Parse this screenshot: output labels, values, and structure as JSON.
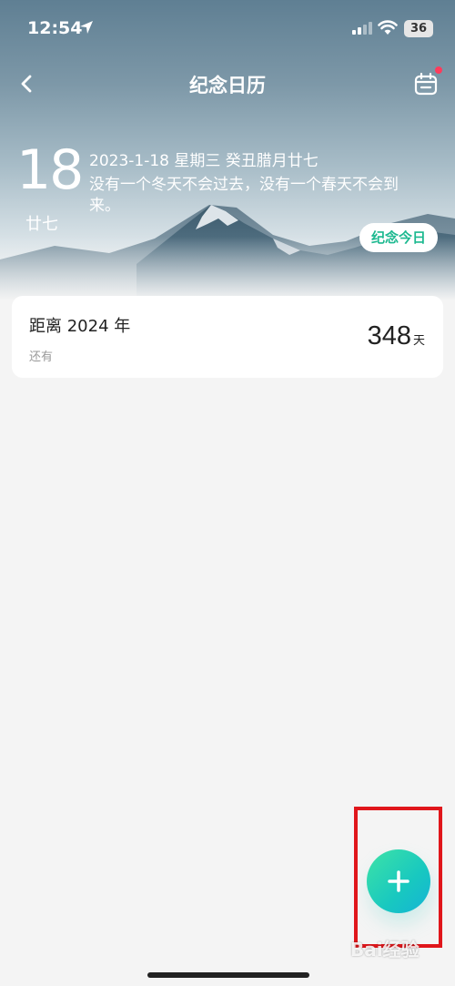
{
  "status_bar": {
    "time": "12:54",
    "battery": "36"
  },
  "nav": {
    "title": "纪念日历",
    "back_icon": "chevron-left-icon",
    "calendar_icon": "calendar-icon"
  },
  "today": {
    "day": "18",
    "lunar_day": "廿七",
    "date_line": "2023-1-18  星期三  癸丑腊月廿七",
    "quote": "没有一个冬天不会过去，没有一个春天不会到来。",
    "memo_button": "纪念今日"
  },
  "countdown_card": {
    "title": "距离 2024 年",
    "subtitle": "还有",
    "count": "348",
    "unit": "天"
  },
  "fab": {
    "icon": "plus-icon"
  },
  "watermark": "Bai经验",
  "colors": {
    "accent": "#1db990",
    "fab_start": "#3ee3a6",
    "fab_end": "#15b3d6",
    "highlight": "#e0161b",
    "badge_dot": "#ff3b5c"
  }
}
